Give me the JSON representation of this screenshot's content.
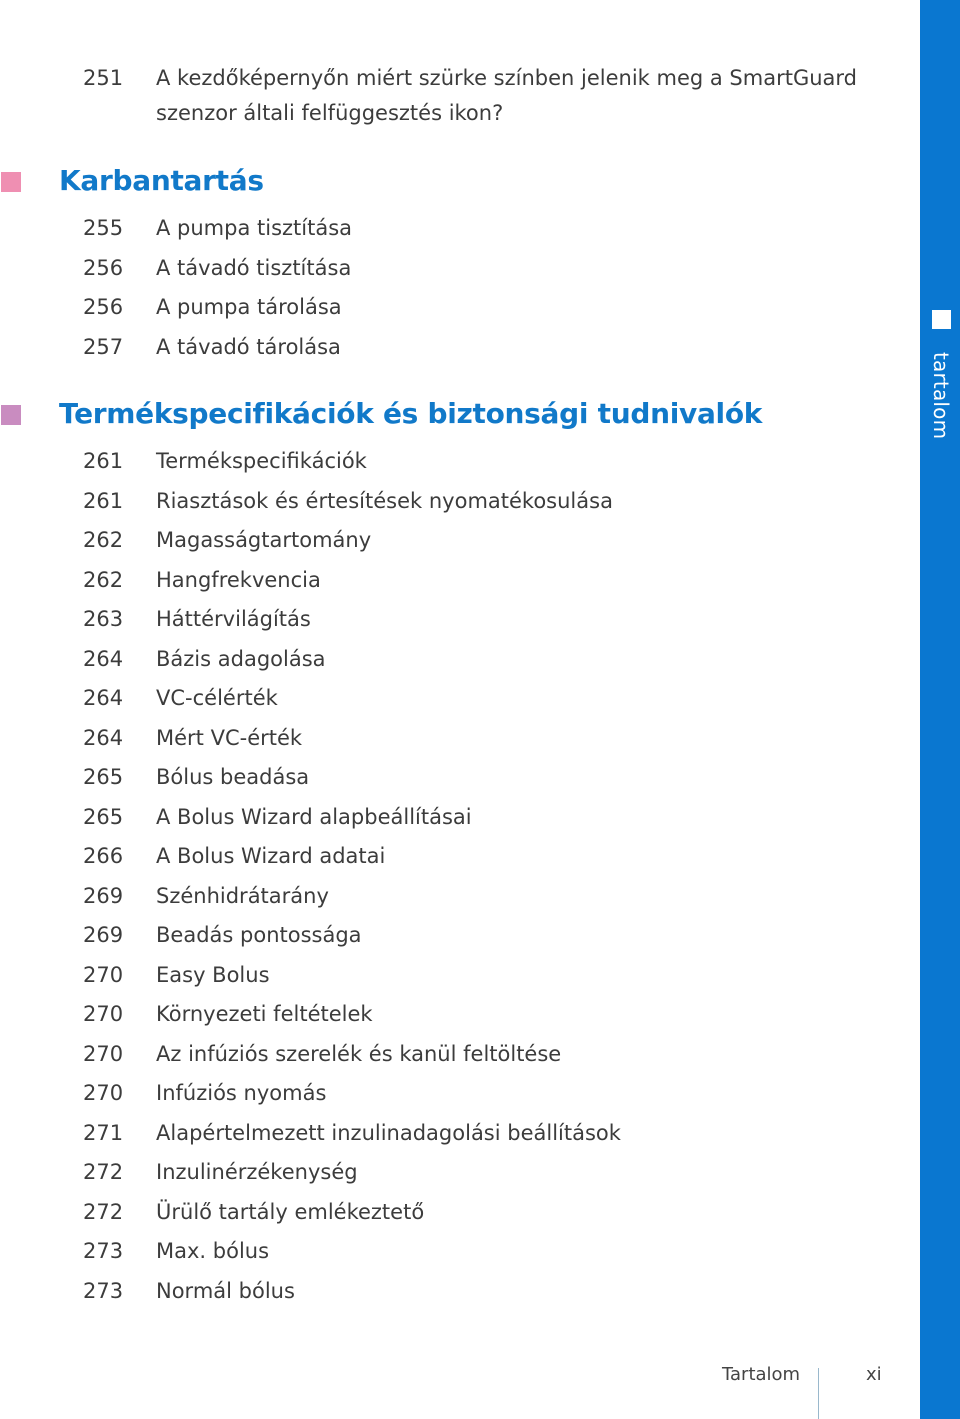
{
  "side_tab": {
    "label": "tartalom",
    "color": "#0a77d0"
  },
  "lead_entry": {
    "page": "251",
    "line1": "A kezdőképernyőn miért szürke színben jelenik meg a SmartGuard",
    "line2": "szenzor általi felfüggesztés ikon?"
  },
  "sections": [
    {
      "title": "Karbantartás",
      "marker_color": "#ef8fb2",
      "entries": [
        {
          "page": "255",
          "title": "A pumpa tisztítása"
        },
        {
          "page": "256",
          "title": "A távadó tisztítása"
        },
        {
          "page": "256",
          "title": "A pumpa tárolása"
        },
        {
          "page": "257",
          "title": "A távadó tárolása"
        }
      ]
    },
    {
      "title": "Termékspecifikációk és biztonsági tudnivalók",
      "marker_color": "#c98cc0",
      "entries": [
        {
          "page": "261",
          "title": "Termékspecifikációk"
        },
        {
          "page": "261",
          "title": "Riasztások és értesítések nyomatékosulása"
        },
        {
          "page": "262",
          "title": "Magasságtartomány"
        },
        {
          "page": "262",
          "title": "Hangfrekvencia"
        },
        {
          "page": "263",
          "title": "Háttérvilágítás"
        },
        {
          "page": "264",
          "title": "Bázis adagolása"
        },
        {
          "page": "264",
          "title": "VC-célérték"
        },
        {
          "page": "264",
          "title": "Mért VC-érték"
        },
        {
          "page": "265",
          "title": "Bólus beadása"
        },
        {
          "page": "265",
          "title": "A Bolus Wizard alapbeállításai"
        },
        {
          "page": "266",
          "title": "A Bolus Wizard adatai"
        },
        {
          "page": "269",
          "title": "Szénhidrátarány"
        },
        {
          "page": "269",
          "title": "Beadás pontossága"
        },
        {
          "page": "270",
          "title": "Easy Bolus"
        },
        {
          "page": "270",
          "title": "Környezeti feltételek"
        },
        {
          "page": "270",
          "title": "Az infúziós szerelék és kanül feltöltése"
        },
        {
          "page": "270",
          "title": "Infúziós nyomás"
        },
        {
          "page": "271",
          "title": "Alapértelmezett inzulinadagolási beállítások"
        },
        {
          "page": "272",
          "title": "Inzulinérzékenység"
        },
        {
          "page": "272",
          "title": "Ürülő tartály emlékeztető"
        },
        {
          "page": "273",
          "title": "Max. bólus"
        },
        {
          "page": "273",
          "title": "Normál bólus"
        }
      ]
    }
  ],
  "footer": {
    "label": "Tartalom",
    "page": "xi"
  }
}
